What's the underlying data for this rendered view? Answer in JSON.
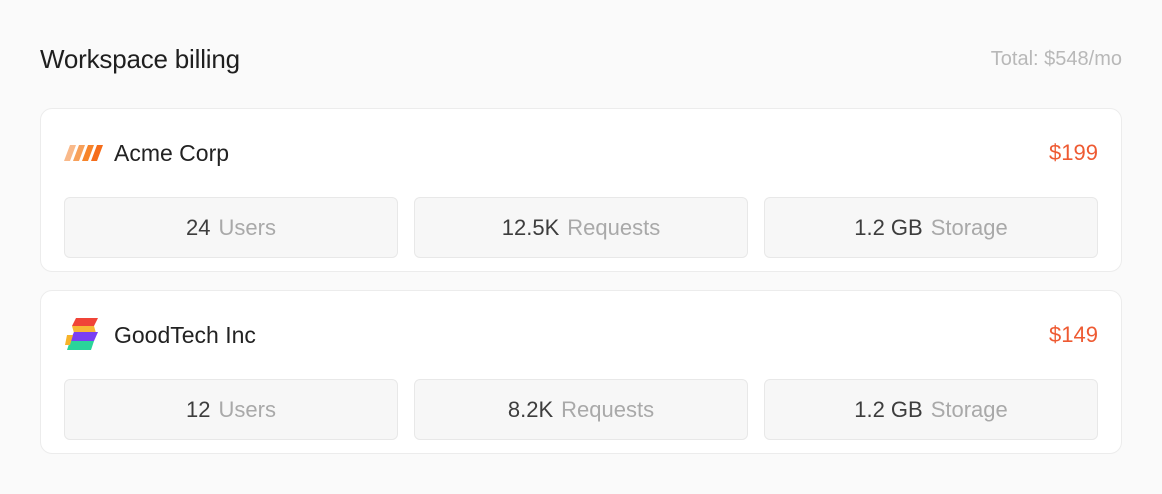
{
  "header": {
    "title": "Workspace billing",
    "total": "Total: $548/mo"
  },
  "workspaces": [
    {
      "name": "Acme Corp",
      "logo": "acme-stripes-icon",
      "price": "$199",
      "stats": [
        {
          "value": "24",
          "label": "Users"
        },
        {
          "value": "12.5K",
          "label": "Requests"
        },
        {
          "value": "1.2 GB",
          "label": "Storage"
        }
      ]
    },
    {
      "name": "GoodTech Inc",
      "logo": "goodtech-s-icon",
      "price": "$149",
      "stats": [
        {
          "value": "12",
          "label": "Users"
        },
        {
          "value": "8.2K",
          "label": "Requests"
        },
        {
          "value": "1.2 GB",
          "label": "Storage"
        }
      ]
    }
  ],
  "colors": {
    "price": "#ee5a32",
    "acme_logo": "#f7842a",
    "goodtech_logo": [
      "#f04438",
      "#7a3ff2",
      "#2ad49a",
      "#f7b32a"
    ]
  }
}
